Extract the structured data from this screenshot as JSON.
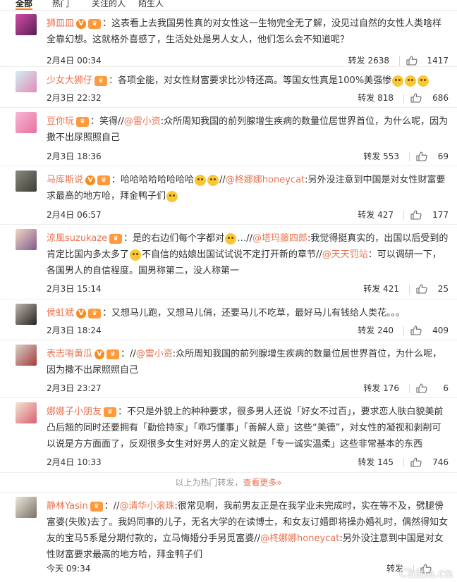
{
  "tabs": [
    {
      "label": "全部",
      "active": true
    },
    {
      "label": "热门"
    },
    {
      "label": "关注的人"
    },
    {
      "label": "陌生人"
    }
  ],
  "comments": [
    {
      "username": "狮皿皿",
      "verified": true,
      "medal": true,
      "segments": [
        {
          "t": "text",
          "v": "：这表看上去我国男性真的对女性这一生物完全无了解，没见过自然的女性人类啥样全靠幻想。这就格外喜感了，生活处处是男人女人，他们怎么会不知道呢？"
        }
      ],
      "date": "2月4日 00:34",
      "repost": "转发 2638",
      "likes": "1417",
      "avatar_colors": [
        "#d04ea6",
        "#5a1d52"
      ]
    },
    {
      "username": "少女大狮仔",
      "verified": false,
      "medal": true,
      "segments": [
        {
          "t": "text",
          "v": "：各项全能，对女性财富要求比沙特还高。等国女性真是100%美强惨"
        },
        {
          "t": "emoji",
          "v": "laugh-cry-emoji"
        },
        {
          "t": "emoji",
          "v": "laugh-cry-emoji"
        },
        {
          "t": "emoji",
          "v": "laugh-cry-emoji"
        }
      ],
      "date": "2月3日 22:32",
      "repost": "转发 818",
      "likes": "686",
      "avatar_colors": [
        "#cfeef2",
        "#e58bb8"
      ]
    },
    {
      "username": "豆你玩",
      "verified": false,
      "medal": true,
      "segments": [
        {
          "t": "text",
          "v": "：笑得//"
        },
        {
          "t": "at",
          "v": "@雷小资"
        },
        {
          "t": "text",
          "v": ":众所周知我国的前列腺增生疾病的数量位居世界首位，为什么呢，因为撒不出尿照照自己"
        }
      ],
      "date": "2月3日 18:36",
      "repost": "转发 553",
      "likes": "69",
      "avatar_colors": [
        "#f6b9d1",
        "#e86fa4"
      ]
    },
    {
      "username": "马库斯说",
      "verified": true,
      "medal": true,
      "segments": [
        {
          "t": "text",
          "v": "：哈哈哈哈哈哈哈哈"
        },
        {
          "t": "emoji",
          "v": "laugh-emoji"
        },
        {
          "t": "emoji",
          "v": "laugh-emoji"
        },
        {
          "t": "text",
          "v": "//"
        },
        {
          "t": "at",
          "v": "@柊娜娜honeycat"
        },
        {
          "t": "text",
          "v": ":另外没注意到中国是对女性财富要求最高的地方哈，拜金鸭子们"
        },
        {
          "t": "emoji",
          "v": "scared-emoji"
        }
      ],
      "date": "2月4日 06:57",
      "repost": "转发 427",
      "likes": "177",
      "avatar_colors": [
        "#8a8a80",
        "#3d3d36"
      ]
    },
    {
      "username": "涼風suzukaze",
      "verified": false,
      "medal": true,
      "segments": [
        {
          "t": "text",
          "v": "：是的右边们每个字都对"
        },
        {
          "t": "emoji",
          "v": "smile-emoji"
        },
        {
          "t": "text",
          "v": "…//"
        },
        {
          "t": "at",
          "v": "@塔玛藤四郎"
        },
        {
          "t": "text",
          "v": ":我觉得挺真实的，出国以后受到的肯定比国内多太多了"
        },
        {
          "t": "emoji",
          "v": "smile-emoji"
        },
        {
          "t": "text",
          "v": "不自信的姑娘出国试试说不定打开新的章节//"
        },
        {
          "t": "at",
          "v": "@天天罚站"
        },
        {
          "t": "text",
          "v": "：可以调研一下，各国男人的自信程度。国男称第二，没人称第一"
        }
      ],
      "date": "2月3日 15:14",
      "repost": "转发 421",
      "likes": "25",
      "avatar_colors": [
        "#f2d7c4",
        "#7f5a8a"
      ]
    },
    {
      "username": "侯虹斌",
      "verified": true,
      "medal": true,
      "segments": [
        {
          "t": "text",
          "v": "：又想马儿跑，又想马儿俏，还要马儿不吃草，最好马儿有钱给人类花。。。"
        }
      ],
      "date": "2月3日 18:24",
      "repost": "转发 240",
      "likes": "409",
      "avatar_colors": [
        "#bdb6b0",
        "#2a2222"
      ]
    },
    {
      "username": "表志哨黄瓜",
      "verified": true,
      "medal": true,
      "segments": [
        {
          "t": "text",
          "v": "：//"
        },
        {
          "t": "at",
          "v": "@雷小资"
        },
        {
          "t": "text",
          "v": ":众所周知我国的前列腺增生疾病的数量位居世界首位，为什么呢，因为撒不出尿照照自己"
        }
      ],
      "date": "2月3日 23:27",
      "repost": "转发 176",
      "likes": "6",
      "avatar_colors": [
        "#d9d2c9",
        "#a33c3c"
      ]
    },
    {
      "username": "娜娜子小朋友",
      "verified": false,
      "medal": true,
      "segments": [
        {
          "t": "text",
          "v": "：不只是外貌上的种种要求，很多男人还说「好女不过百」，要求恋人肤白貌美前凸后翘的同时还要拥有「勤俭持家」「乖巧懂事」「善解人意」这些“美德”，对女性的凝视和剥削可以说是方方面面了，反观很多女生对好男人的定义就是「专一诚实温柔」这些非常基本的东西"
        }
      ],
      "date": "2月4日 10:33",
      "repost": "转发 145",
      "likes": "746",
      "avatar_colors": [
        "#f3e6d0",
        "#d95f74"
      ]
    }
  ],
  "more_bar": {
    "prefix": "以上为热门转发，",
    "link": "查看更多»"
  },
  "last_comment": {
    "username": "静林Yasin",
    "verified": false,
    "medal": true,
    "segments": [
      {
        "t": "text",
        "v": "：//"
      },
      {
        "t": "at",
        "v": "@清华小滚珠"
      },
      {
        "t": "text",
        "v": ":很常见啊，我前男友正是在我学业未完成时，实在等不及，劈腿傍富婆(失败)去了。我妈同事的儿子，无名大学的在读博士，和女友订婚即将操办婚礼时，偶然得知女友的宝马5系是分期付款的，立马悔婚分手另觅富婆//"
      },
      {
        "t": "at",
        "v": "@柊娜娜honeycat"
      },
      {
        "t": "text",
        "v": ":另外没注意到中国是对女性财富要求最高的地方哈，拜金鸭子们"
      }
    ],
    "date": "今天 09:34",
    "repost": "转发",
    "likes": "",
    "avatar_colors": [
      "#ece8e0",
      "#7a6f61"
    ]
  },
  "watermark": "China.cn",
  "colors": {
    "name": "#eb7350",
    "tab_underline": "#ff8200",
    "vip": "#f78b1e",
    "text": "#333333",
    "divider": "#eeeeee"
  }
}
